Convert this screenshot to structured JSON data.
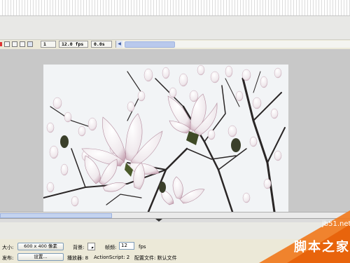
{
  "timeline": {
    "frame_field": "1",
    "fps_field": "12.0 fps",
    "time_field": "0.0s",
    "scroll_arrow": "◀",
    "icons": [
      "onion-skin-icon",
      "onion-outline-icon",
      "edit-multiple-frames-icon",
      "modify-markers-icon"
    ]
  },
  "properties": {
    "size_label": "大小:",
    "size_button": "600 x 400 像素",
    "background_label": "背景:",
    "background_color": "#ffffff",
    "framerate_label": "帧频:",
    "framerate_value": "12",
    "fps_unit": "fps",
    "publish_label": "发布:",
    "settings_button": "设置...",
    "player_label": "播放器: 8",
    "actionscript_label": "ActionScript: 2",
    "profile_label": "配置文件: 默认文件"
  },
  "watermark": {
    "site": "jb51.net",
    "name": "脚本之家"
  },
  "colors": {
    "stage_background": "#c8c8c8",
    "scroll_accent": "#b9c9ec",
    "watermark_orange": "#f07a1e"
  }
}
